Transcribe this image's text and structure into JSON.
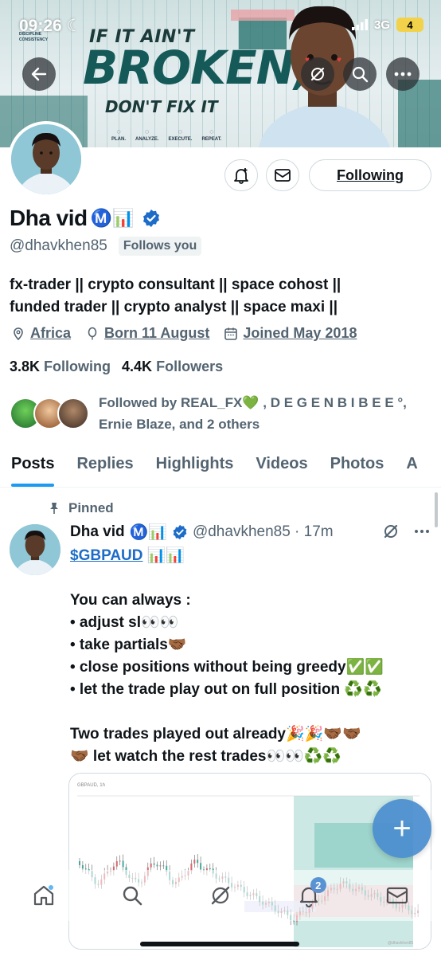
{
  "status_bar": {
    "time": "09:26",
    "network": "3G",
    "battery": "4"
  },
  "banner": {
    "line1": "IF IT AIN'T",
    "line2": "BROKEN,",
    "line3": "DON'T FIX IT",
    "tagline": "DISCIPLINE\nCONSISTENCY",
    "steps": [
      "PLAN.",
      "ANALYZE.",
      "EXECUTE.",
      "REPEAT."
    ]
  },
  "profile": {
    "name": "Dha vid",
    "name_emojis": "Ⓜ️📊",
    "handle": "@dhavkhen85",
    "follows_you": "Follows you",
    "follow_button": "Following",
    "bio_line1": "fx-trader || crypto consultant || space cohost ||",
    "bio_line2": "funded trader || crypto analyst || space maxi ||",
    "location": "Africa",
    "birthday": "Born 11 August",
    "joined": "Joined May 2018",
    "following_count": "3.8K",
    "following_label": "Following",
    "followers_count": "4.4K",
    "followers_label": "Followers",
    "followed_by_line1": "Followed by REAL_FX💚 , D E G E N B I B E E °,",
    "followed_by_line2": "Ernie Blaze, and 2 others"
  },
  "tabs": [
    "Posts",
    "Replies",
    "Highlights",
    "Videos",
    "Photos",
    "A"
  ],
  "post": {
    "pinned_label": "Pinned",
    "author": "Dha vid",
    "author_emojis": "Ⓜ️📊",
    "handle_time": "@dhavkhen85 · 17m",
    "cashtag": "$GBPAUD",
    "cashtag_emojis": " 📊📊",
    "lines": [
      "",
      "You can always :",
      "• adjust sl👀👀",
      "• take partials🤝🏾",
      "• close positions without being greedy✅✅",
      "• let the trade play out on full position ♻️♻️",
      "",
      "Two trades played out already🎉🎉🤝🏾🤝🏾",
      "🤝🏾 let watch the rest trades👀👀♻️♻️"
    ],
    "chart_label": "GBPAUD, 1h",
    "chart_watermark": "@dhavkhen85"
  },
  "bottom_nav": {
    "notification_badge": "2"
  },
  "fab_label": "+"
}
